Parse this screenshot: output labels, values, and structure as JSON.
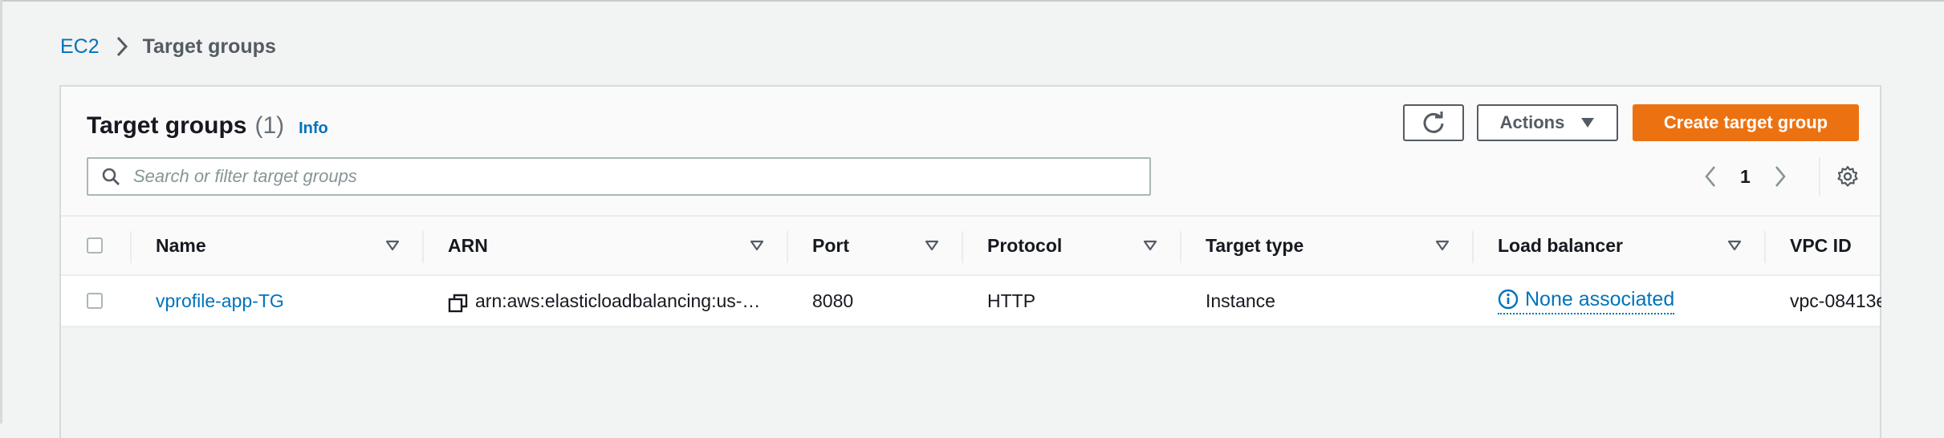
{
  "breadcrumb": {
    "root": "EC2",
    "current": "Target groups"
  },
  "panel": {
    "title": "Target groups",
    "count": "(1)",
    "info": "Info"
  },
  "toolbar": {
    "refresh_icon": "refresh-icon",
    "actions_label": "Actions",
    "create_label": "Create target group",
    "create_color": "#ec7211"
  },
  "search": {
    "placeholder": "Search or filter target groups",
    "value": ""
  },
  "pagination": {
    "current_page": "1"
  },
  "table": {
    "columns": [
      "Name",
      "ARN",
      "Port",
      "Protocol",
      "Target type",
      "Load balancer",
      "VPC ID"
    ],
    "rows": [
      {
        "name": "vprofile-app-TG",
        "arn": "arn:aws:elasticloadbalancing:us-…",
        "port": "8080",
        "protocol": "HTTP",
        "target_type": "Instance",
        "load_balancer": "None associated",
        "vpc_id": "vpc-08413e"
      }
    ]
  },
  "colors": {
    "link": "#0073bb",
    "primary_button": "#ec7211",
    "text": "#16191f",
    "muted": "#687078"
  }
}
